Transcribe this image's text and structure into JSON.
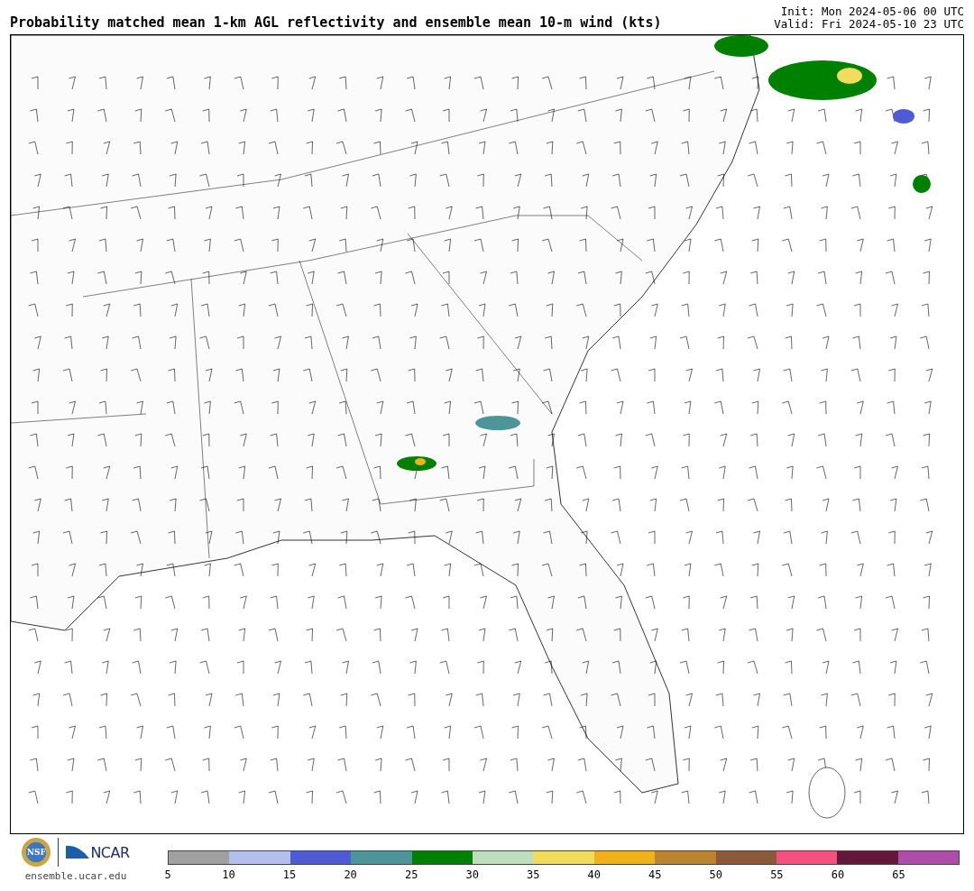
{
  "title": "Probability matched mean 1-km AGL reflectivity and ensemble mean 10-m wind (kts)",
  "init": "Init: Mon 2024-05-06 00 UTC",
  "valid": "Valid: Fri 2024-05-10 23 UTC",
  "logos": {
    "nsf": "NSF",
    "ncar": "NCAR",
    "site": "ensemble.ucar.edu"
  },
  "colorbar": {
    "segments": [
      {
        "color": "#a0a0a0"
      },
      {
        "color": "#b4c0ec"
      },
      {
        "color": "#4f5bd5"
      },
      {
        "color": "#4d9598"
      },
      {
        "color": "#008000"
      },
      {
        "color": "#bddfbd"
      },
      {
        "color": "#f2dc5d"
      },
      {
        "color": "#f2b01a"
      },
      {
        "color": "#bd842f"
      },
      {
        "color": "#8b5a3c"
      },
      {
        "color": "#f45080"
      },
      {
        "color": "#641738"
      },
      {
        "color": "#ae4ca8"
      }
    ],
    "ticks": [
      "5",
      "10",
      "15",
      "20",
      "25",
      "30",
      "35",
      "40",
      "45",
      "50",
      "55",
      "60",
      "65"
    ]
  }
}
